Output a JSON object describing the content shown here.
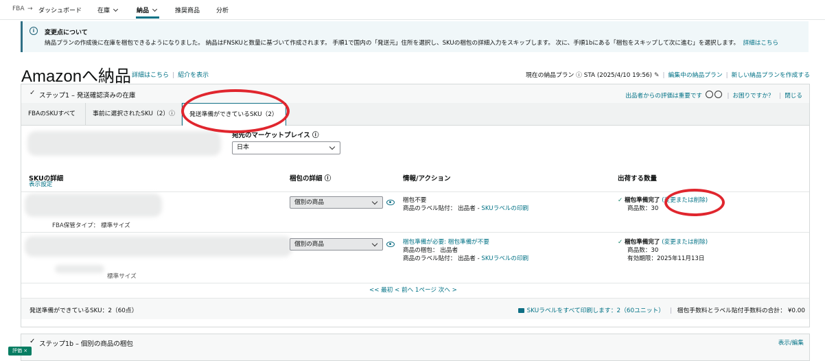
{
  "nav": {
    "items": [
      {
        "label": "FBA"
      },
      {
        "label": "ダッシュボード"
      },
      {
        "label": "在庫"
      },
      {
        "label": "納品"
      },
      {
        "label": "推奨商品"
      },
      {
        "label": "分析"
      }
    ]
  },
  "alert": {
    "title": "変更点について",
    "body": "納品プランの作成後に在庫を梱包できるようになりました。 納品はFNSKUと数量に基づいて作成されます。 手順1で国内の「発送元」住所を選択し、SKUの梱包の詳細入力をスキップします。 次に、手順1bにある「梱包をスキップして次に進む」を選択します。",
    "link": "詳細はこちら"
  },
  "page": {
    "title": "Amazonへ納品",
    "links": [
      "詳細はこちら",
      "紹介を表示"
    ],
    "current_plan": "現在の納品プラン ⓘ STA (2025/4/10 19:56)",
    "edit_plans": "編集中の納品プラン",
    "new_plan": "新しい納品プランを作成する"
  },
  "step1": {
    "title": "ステップ1 – 発送確認済みの在庫",
    "feedback": "出品者からの評価は重要です",
    "help": "お困りですか？",
    "close": "閉じる",
    "tabs": [
      {
        "label": "FBAのSKUすべて"
      },
      {
        "label": "事前に選択されたSKU（2）ⓘ"
      },
      {
        "label": "発送準備ができているSKU（2）"
      }
    ],
    "marketplace_label": "宛先のマーケットプレイス ⓘ",
    "marketplace_value": "日本"
  },
  "table": {
    "headers": {
      "sku": "SKUの詳細",
      "display_settings": "表示設定",
      "packing": "梱包の詳細 ⓘ",
      "info": "情報/アクション",
      "qty": "出荷する数量"
    },
    "rows": [
      {
        "storage_type": "FBA保管タイプ： 標準サイズ",
        "packing": "個別の商品",
        "info_line1": "梱包不要",
        "info_line2_prefix": "商品のラベル貼付： 出品者 - ",
        "info_line2_link": "SKUラベルの印刷",
        "status": "梱包準備完了",
        "change": "(変更または削除)",
        "count": "商品数：30"
      },
      {
        "storage_type": "標準サイズ",
        "packing": "個別の商品",
        "info_line1_link": "梱包準備が必要: 梱包準備が不要",
        "info_line2": "商品の梱包： 出品者",
        "info_line3_prefix": "商品のラベル貼付： 出品者 - ",
        "info_line3_link": "SKUラベルの印刷",
        "status": "梱包準備完了",
        "change": "(変更または削除)",
        "count": "商品数：30",
        "expiry": "有効期限：2025年11月13日"
      }
    ],
    "pager": "<< 最初  < 前へ   1ページ  次へ >"
  },
  "footer": {
    "ready_sku": "発送準備ができているSKU：2（60点）",
    "print_all": "SKUラベルをすべて印刷します：2（60ユニット）",
    "fee": "梱包手数料とラベル貼付手数料の合計：  ¥0.00"
  },
  "step1b": {
    "title": "ステップ1b – 個別の商品の梱包",
    "right": "表示/編集"
  },
  "badge": "評価 ×",
  "colors": {
    "link": "#007185",
    "accent": "#0f6f85",
    "success": "#067d62",
    "annotation": "#e0262e"
  }
}
